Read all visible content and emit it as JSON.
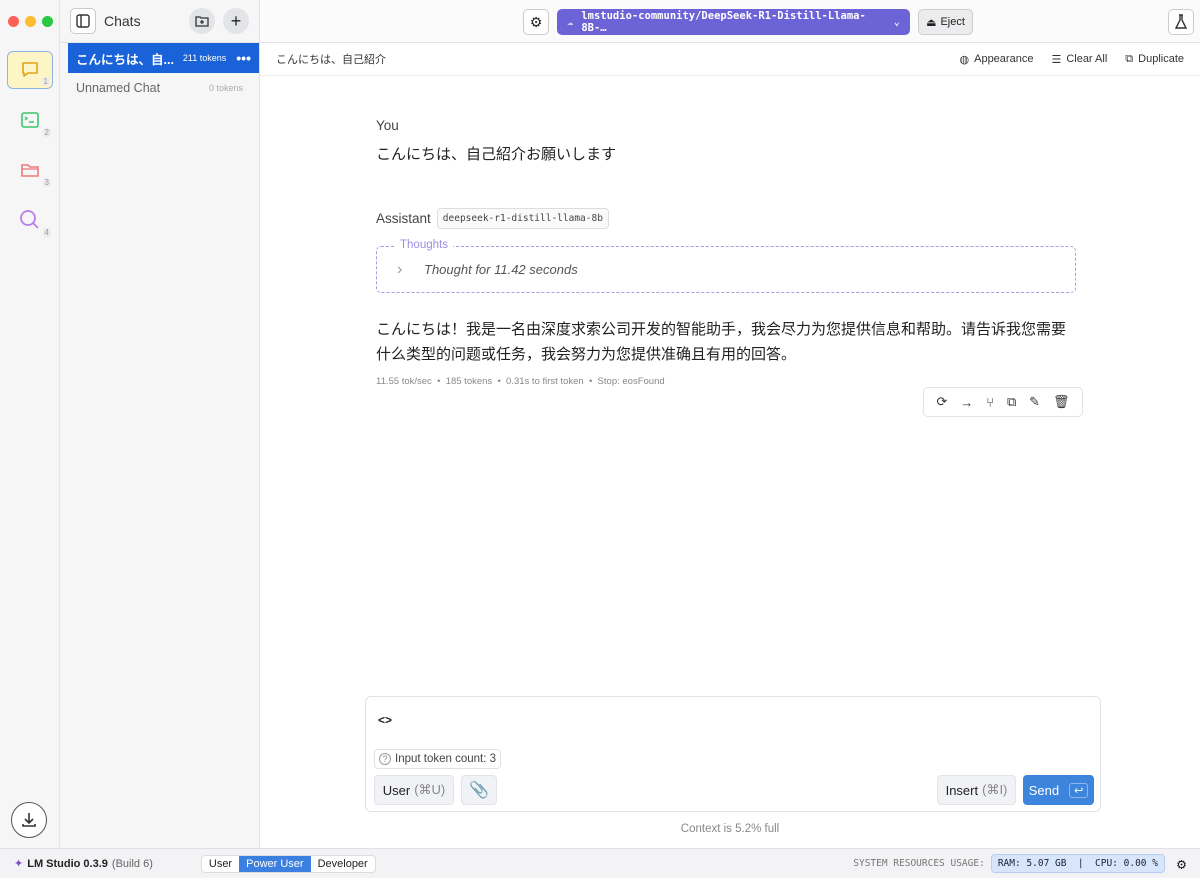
{
  "sidebar": {
    "items": [
      {
        "name": "chat",
        "num": "1"
      },
      {
        "name": "developer",
        "num": "2"
      },
      {
        "name": "models",
        "num": "3"
      },
      {
        "name": "discover",
        "num": "4"
      }
    ]
  },
  "chats": {
    "title": "Chats",
    "items": [
      {
        "title": "こんにちは、自...",
        "tokens": "211 tokens"
      },
      {
        "title": "Unnamed Chat",
        "tokens": "0 tokens"
      }
    ]
  },
  "header": {
    "model": "lmstudio-community/DeepSeek-R1-Distill-Llama-8B-…",
    "eject": "Eject"
  },
  "subheader": {
    "title": "こんにちは、自己紹介",
    "appearance": "Appearance",
    "clear_all": "Clear All",
    "duplicate": "Duplicate"
  },
  "conversation": {
    "user_label": "You",
    "user_message": "こんにちは、自己紹介お願いします",
    "assistant_label": "Assistant",
    "model_tag": "deepseek-r1-distill-llama-8b",
    "thoughts_label": "Thoughts",
    "thought_summary": "Thought for 11.42 seconds",
    "assistant_message": "こんにちは！我是一名由深度求索公司开发的智能助手，我会尽力为您提供信息和帮助。请告诉我您需要什么类型的问题或任务，我会努力为您提供准确且有用的回答。",
    "stats": "11.55 tok/sec  •  185 tokens  •  0.31s to first token  •  Stop: eosFound"
  },
  "input": {
    "value": "<>",
    "token_count": "Input token count: 3",
    "role_button": "User",
    "role_shortcut": "(⌘U)",
    "insert": "Insert",
    "insert_shortcut": "(⌘I)",
    "send": "Send",
    "context": "Context is 5.2% full"
  },
  "status": {
    "app": "LM Studio 0.3.9",
    "build": "(Build 6)",
    "modes": [
      "User",
      "Power User",
      "Developer"
    ],
    "active_mode": "Power User",
    "resources_label": "SYSTEM RESOURCES USAGE:",
    "resources": "RAM: 5.07 GB  |  CPU: 0.00 %"
  }
}
